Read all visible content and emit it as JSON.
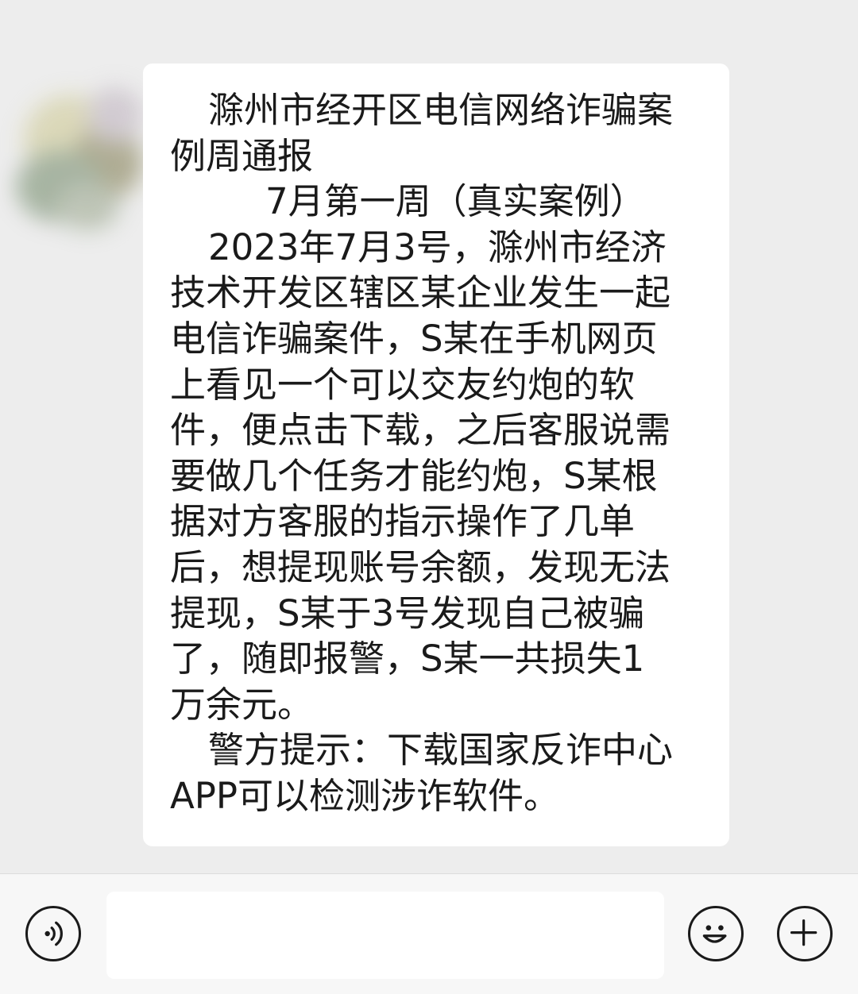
{
  "message": {
    "lines": [
      "滁州市经开区电信网络诈骗案",
      "例周通报",
      "7月第一周（真实案例）",
      "2023年7月3号，滁州市经济",
      "技术开发区辖区某企业发生一起",
      "电信诈骗案件，S某在手机网页",
      "上看见一个可以交友约炮的软",
      "件，便点击下载，之后客服说需",
      "要做几个任务才能约炮，S某根",
      "据对方客服的指示操作了几单",
      "后，想提现账号余额，发现无法",
      "提现，S某于3号发现自己被骗",
      "了，随即报警，S某一共损失1",
      "万余元。",
      "警方提示：下载国家反诈中心",
      "APP可以检测涉诈软件。"
    ]
  },
  "input_bar": {
    "text_value": "",
    "voice_icon": "voice-icon",
    "emoji_icon": "emoji-icon",
    "plus_icon": "plus-icon"
  },
  "colors": {
    "chat_background": "#ededed",
    "bubble_background": "#ffffff",
    "text": "#1a1a1a",
    "input_bar_background": "#f7f7f7"
  }
}
